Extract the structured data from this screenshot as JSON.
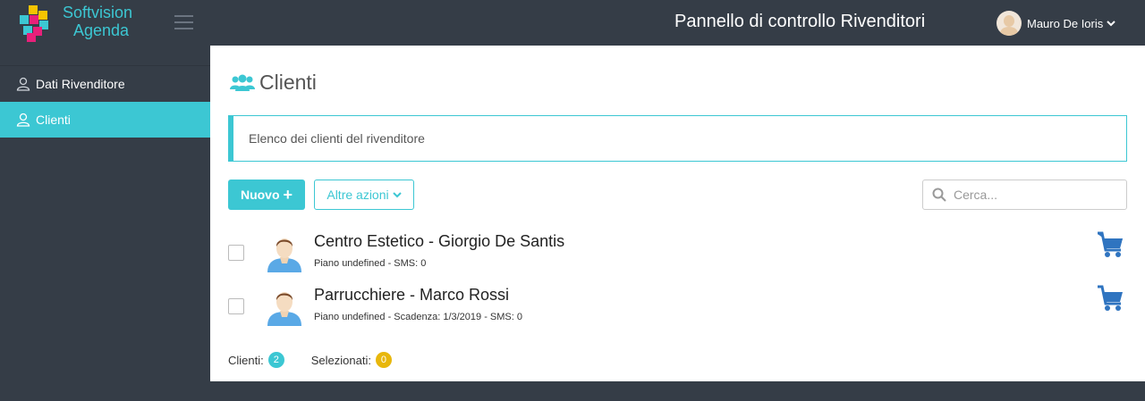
{
  "header": {
    "brand_line1": "Softvision",
    "brand_line2": "Agenda",
    "title": "Pannello di controllo Rivenditori",
    "user_name": "Mauro De Ioris"
  },
  "sidebar": {
    "items": [
      {
        "label": "Dati Rivenditore",
        "active": false
      },
      {
        "label": "Clienti",
        "active": true
      }
    ]
  },
  "main": {
    "title": "Clienti",
    "callout": "Elenco dei clienti del rivenditore",
    "new_button": "Nuovo",
    "more_button": "Altre azioni",
    "search_placeholder": "Cerca...",
    "clients": [
      {
        "name": "Centro Estetico - Giorgio De Santis",
        "meta": "Piano undefined - SMS: 0"
      },
      {
        "name": "Parrucchiere - Marco Rossi",
        "meta": "Piano undefined - Scadenza: 1/3/2019 - SMS: 0"
      }
    ],
    "footer": {
      "clients_label": "Clienti:",
      "clients_count": "2",
      "selected_label": "Selezionati:",
      "selected_count": "0"
    }
  },
  "colors": {
    "accent": "#3cc7d3",
    "dark": "#353d47",
    "cart": "#2f74c0",
    "badge_yellow": "#e8b70c"
  },
  "icons": [
    "logo-icon",
    "menu-icon",
    "user-avatar",
    "user-icon",
    "users-icon",
    "search-icon",
    "person-avatar",
    "cart-icon"
  ]
}
